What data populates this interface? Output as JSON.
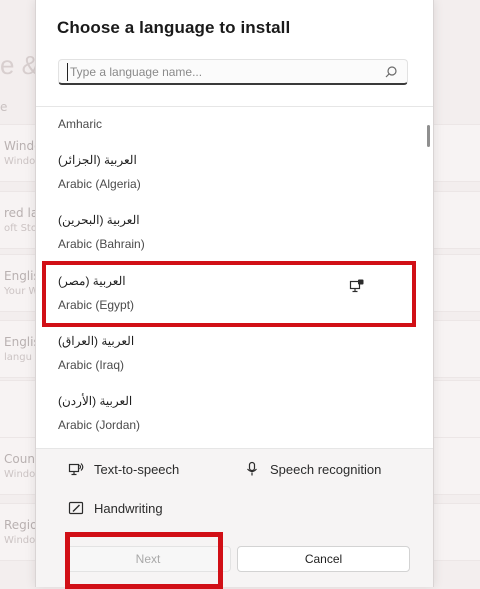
{
  "background": {
    "title_fragment": "e &",
    "sub_fragment": "e",
    "cards": [
      {
        "line1": "Windo",
        "line2": "Windo"
      },
      {
        "line1": "red lan",
        "line2": "oft Stor"
      },
      {
        "line1": "Englis",
        "line2": "Your W"
      },
      {
        "line1": "Englis",
        "line2": "langu"
      },
      {
        "line1": "",
        "line2": ""
      },
      {
        "line1": "Coun",
        "line2": "Windo"
      },
      {
        "line1": "Regio",
        "line2": "Windo"
      }
    ]
  },
  "dialog": {
    "title": "Choose a language to install",
    "search": {
      "placeholder": "Type a language name...",
      "value": ""
    },
    "languages": [
      {
        "native": "",
        "english": "Amharic"
      },
      {
        "native": "العربية (الجزائر)",
        "english": "Arabic (Algeria)"
      },
      {
        "native": "العربية (البحرين)",
        "english": "Arabic (Bahrain)"
      },
      {
        "native": "العربية (مصر)",
        "english": "Arabic (Egypt)",
        "icon": "display-language-icon"
      },
      {
        "native": "العربية (العراق)",
        "english": "Arabic (Iraq)"
      },
      {
        "native": "العربية (الأردن)",
        "english": "Arabic (Jordan)"
      }
    ],
    "features": {
      "text_to_speech": "Text-to-speech",
      "speech_recognition": "Speech recognition",
      "handwriting": "Handwriting"
    },
    "buttons": {
      "next": "Next",
      "cancel": "Cancel"
    },
    "colors": {
      "highlight": "#d10f16",
      "accent_underline": "#3a3a3a"
    }
  }
}
